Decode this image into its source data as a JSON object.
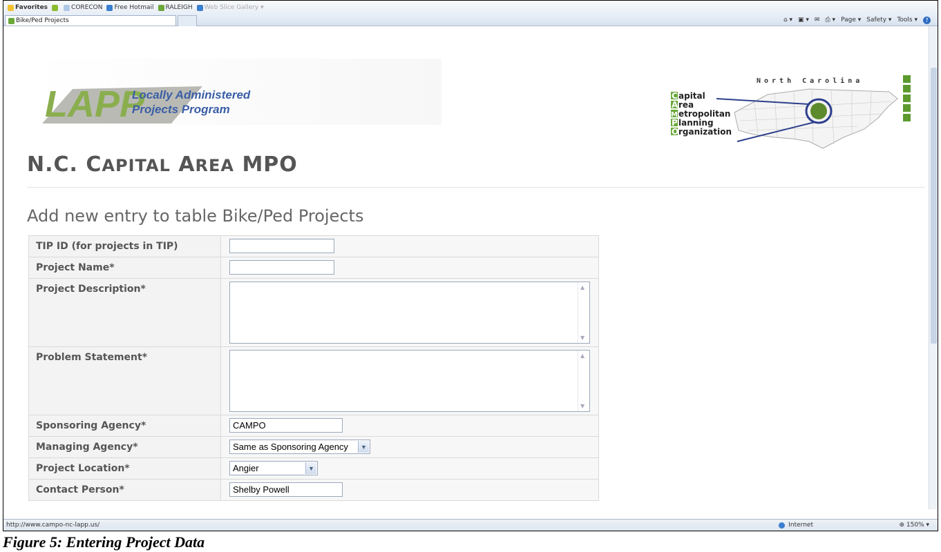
{
  "browser": {
    "favorites_label": "Favorites",
    "favorites_links": [
      "CORECON",
      "Free Hotmail",
      "RALEIGH",
      "Web Slice Gallery"
    ],
    "tab_title": "Bike/Ped Projects",
    "command_items": [
      "Page",
      "Safety",
      "Tools"
    ],
    "status_url": "http://www.campo-nc-lapp.us/",
    "status_zone": "Internet",
    "zoom": "150%"
  },
  "header": {
    "lapp_logo_text": "LAPP",
    "lapp_logo_line1": "Locally Administered",
    "lapp_logo_line2": "Projects Program",
    "campo_state": "North Carolina",
    "campo_words": [
      "apital",
      "rea",
      "etropolitan",
      "lanning",
      "rganization"
    ],
    "campo_initials": [
      "C",
      "A",
      "M",
      "P",
      "O"
    ]
  },
  "site_title": {
    "prefix": "N.C. ",
    "c1": "C",
    "w1": "APITAL",
    "a1": "A",
    "w2": "REA",
    "rest": "MPO"
  },
  "form": {
    "heading": "Add new entry to table Bike/Ped Projects",
    "fields": {
      "tip_id": {
        "label": "TIP ID (for projects in TIP)",
        "value": ""
      },
      "project_name": {
        "label": "Project Name*",
        "value": ""
      },
      "project_description": {
        "label": "Project Description*",
        "value": ""
      },
      "problem_statement": {
        "label": "Problem Statement*",
        "value": ""
      },
      "sponsoring_agency": {
        "label": "Sponsoring Agency*",
        "value": "CAMPO"
      },
      "managing_agency": {
        "label": "Managing Agency*",
        "selected": "Same as Sponsoring Agency"
      },
      "project_location": {
        "label": "Project Location*",
        "selected": "Angier"
      },
      "contact_person": {
        "label": "Contact Person*",
        "value": "Shelby Powell"
      }
    }
  },
  "caption": "Figure 5: Entering Project Data"
}
